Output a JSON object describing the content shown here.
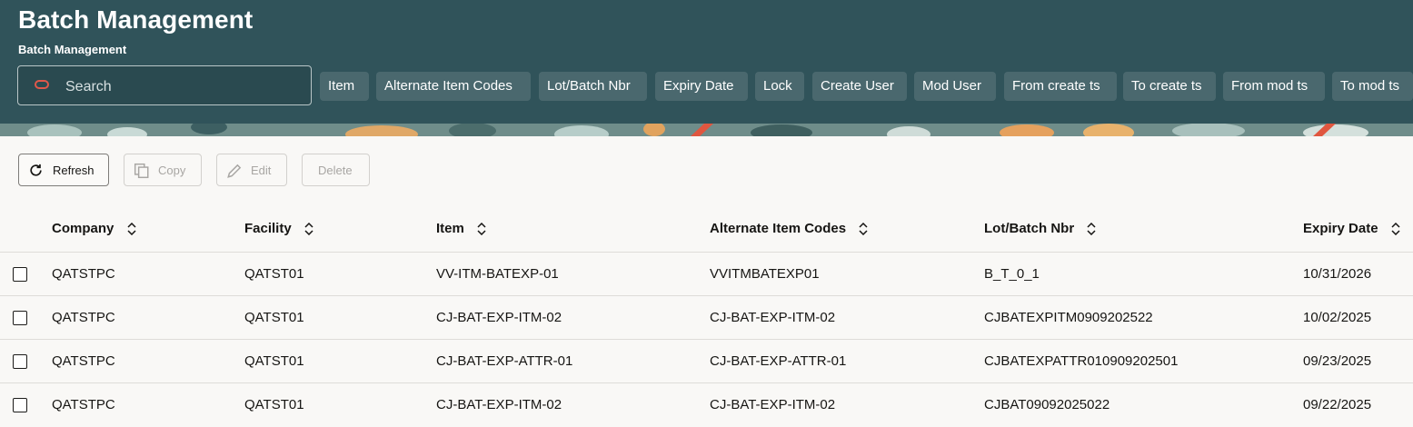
{
  "header": {
    "title": "Batch Management",
    "subtitle": "Batch Management"
  },
  "search": {
    "placeholder": "Search",
    "icon": "oracle-icon"
  },
  "filter_chips": [
    "Item",
    "Alternate Item Codes",
    "Lot/Batch Nbr",
    "Expiry Date",
    "Lock",
    "Create User",
    "Mod User",
    "From create ts",
    "To create ts",
    "From mod ts",
    "To mod ts"
  ],
  "toolbar": {
    "refresh": "Refresh",
    "copy": "Copy",
    "edit": "Edit",
    "delete": "Delete"
  },
  "table": {
    "columns": [
      "Company",
      "Facility",
      "Item",
      "Alternate Item Codes",
      "Lot/Batch Nbr",
      "Expiry Date"
    ],
    "rows": [
      [
        "QATSTPC",
        "QATST01",
        "VV-ITM-BATEXP-01",
        "VVITMBATEXP01",
        "B_T_0_1",
        "10/31/2026"
      ],
      [
        "QATSTPC",
        "QATST01",
        "CJ-BAT-EXP-ITM-02",
        "CJ-BAT-EXP-ITM-02",
        "CJBATEXPITM0909202522",
        "10/02/2025"
      ],
      [
        "QATSTPC",
        "QATST01",
        "CJ-BAT-EXP-ATTR-01",
        "CJ-BAT-EXP-ATTR-01",
        "CJBATEXPATTR010909202501",
        "09/23/2025"
      ],
      [
        "QATSTPC",
        "QATST01",
        "CJ-BAT-EXP-ITM-02",
        "CJ-BAT-EXP-ITM-02",
        "CJBAT09092025022",
        "09/22/2025"
      ]
    ]
  },
  "colors": {
    "header_bg": "#30535a",
    "chip_bg": "#4a686e",
    "accent": "#e0584a"
  }
}
